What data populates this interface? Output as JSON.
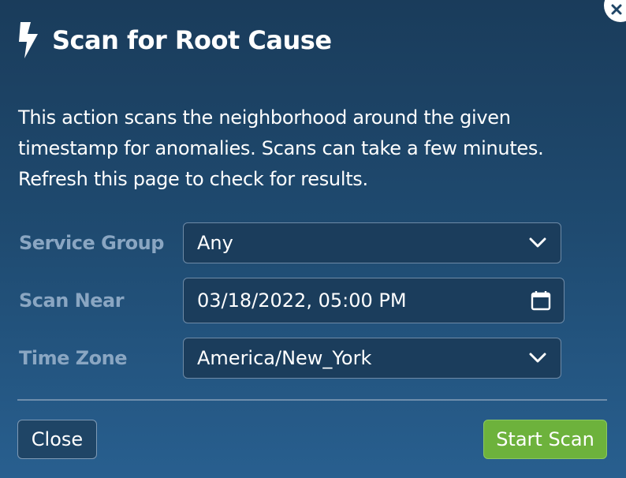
{
  "dialog": {
    "title": "Scan for Root Cause",
    "title_icon": "lightning-bolt-icon",
    "close_icon": "close-icon",
    "description": "This action scans the neighborhood around the given timestamp for anomalies. Scans can take a few minutes. Refresh this page to check for results."
  },
  "form": {
    "service_group": {
      "label": "Service Group",
      "value": "Any",
      "icon": "chevron-down-icon"
    },
    "scan_near": {
      "label": "Scan Near",
      "value": "03/18/2022, 05:00 PM",
      "icon": "calendar-icon"
    },
    "time_zone": {
      "label": "Time Zone",
      "value": "America/New_York",
      "icon": "chevron-down-icon"
    }
  },
  "footer": {
    "close_label": "Close",
    "start_label": "Start Scan"
  },
  "colors": {
    "background_top": "#1a3c5b",
    "background_bottom": "#285f8f",
    "label": "#8aa6c2",
    "start_button": "#6db23c"
  }
}
